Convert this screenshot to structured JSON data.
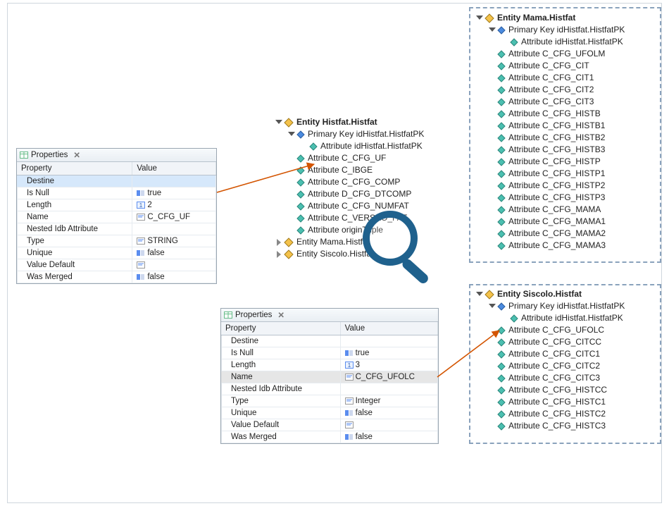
{
  "panel1": {
    "title": "Properties",
    "close_glyph": "✕",
    "col_property": "Property",
    "col_value": "Value",
    "rows": [
      {
        "name": "Destine",
        "value": "",
        "icon": ""
      },
      {
        "name": "Is Null",
        "value": "true",
        "icon": "bool"
      },
      {
        "name": "Length",
        "value": "2",
        "icon": "num"
      },
      {
        "name": "Name",
        "value": "C_CFG_UF",
        "icon": "txt"
      },
      {
        "name": "Nested Idb Attribute",
        "value": "",
        "icon": ""
      },
      {
        "name": "Type",
        "value": "STRING",
        "icon": "txt"
      },
      {
        "name": "Unique",
        "value": "false",
        "icon": "bool"
      },
      {
        "name": "Value Default",
        "value": "",
        "icon": "txt"
      },
      {
        "name": "Was Merged",
        "value": "false",
        "icon": "bool"
      }
    ]
  },
  "panel2": {
    "title": "Properties",
    "close_glyph": "✕",
    "col_property": "Property",
    "col_value": "Value",
    "rows": [
      {
        "name": "Destine",
        "value": "",
        "icon": ""
      },
      {
        "name": "Is Null",
        "value": "true",
        "icon": "bool"
      },
      {
        "name": "Length",
        "value": "3",
        "icon": "num"
      },
      {
        "name": "Name",
        "value": "C_CFG_UFOLC",
        "icon": "txt"
      },
      {
        "name": "Nested Idb Attribute",
        "value": "",
        "icon": ""
      },
      {
        "name": "Type",
        "value": "Integer",
        "icon": "txt"
      },
      {
        "name": "Unique",
        "value": "false",
        "icon": "bool"
      },
      {
        "name": "Value Default",
        "value": "",
        "icon": "txt"
      },
      {
        "name": "Was Merged",
        "value": "false",
        "icon": "bool"
      }
    ]
  },
  "tree_center": {
    "entity": "Entity Histfat.Histfat",
    "pk": "Primary Key idHistfat.HistfatPK",
    "pkattr": "Attribute idHistfat.HistfatPK",
    "attrs": [
      "Attribute C_CFG_UF",
      "Attribute C_IBGE",
      "Attribute C_CFG_COMP",
      "Attribute D_CFG_DTCOMP",
      "Attribute C_CFG_NUMFAT",
      "Attribute C_VERSAO_FAT",
      "Attribute originTuple"
    ],
    "sub1": "Entity Mama.Histfat",
    "sub2": "Entity Siscolo.Histfat"
  },
  "tree_mama": {
    "entity": "Entity Mama.Histfat",
    "pk": "Primary Key idHistfat.HistfatPK",
    "pkattr": "Attribute idHistfat.HistfatPK",
    "attrs": [
      "Attribute C_CFG_UFOLM",
      "Attribute C_CFG_CIT",
      "Attribute C_CFG_CIT1",
      "Attribute C_CFG_CIT2",
      "Attribute C_CFG_CIT3",
      "Attribute C_CFG_HISTB",
      "Attribute C_CFG_HISTB1",
      "Attribute C_CFG_HISTB2",
      "Attribute C_CFG_HISTB3",
      "Attribute C_CFG_HISTP",
      "Attribute C_CFG_HISTP1",
      "Attribute C_CFG_HISTP2",
      "Attribute C_CFG_HISTP3",
      "Attribute C_CFG_MAMA",
      "Attribute C_CFG_MAMA1",
      "Attribute C_CFG_MAMA2",
      "Attribute C_CFG_MAMA3"
    ]
  },
  "tree_siscolo": {
    "entity": "Entity Siscolo.Histfat",
    "pk": "Primary Key idHistfat.HistfatPK",
    "pkattr": "Attribute idHistfat.HistfatPK",
    "attrs": [
      "Attribute C_CFG_UFOLC",
      "Attribute C_CFG_CITCC",
      "Attribute C_CFG_CITC1",
      "Attribute C_CFG_CITC2",
      "Attribute C_CFG_CITC3",
      "Attribute C_CFG_HISTCC",
      "Attribute C_CFG_HISTC1",
      "Attribute C_CFG_HISTC2",
      "Attribute C_CFG_HISTC3"
    ]
  },
  "colors": {
    "arrow": "#d35400",
    "magnifier": "#1f618d",
    "dashed": "#8aa2bc"
  }
}
